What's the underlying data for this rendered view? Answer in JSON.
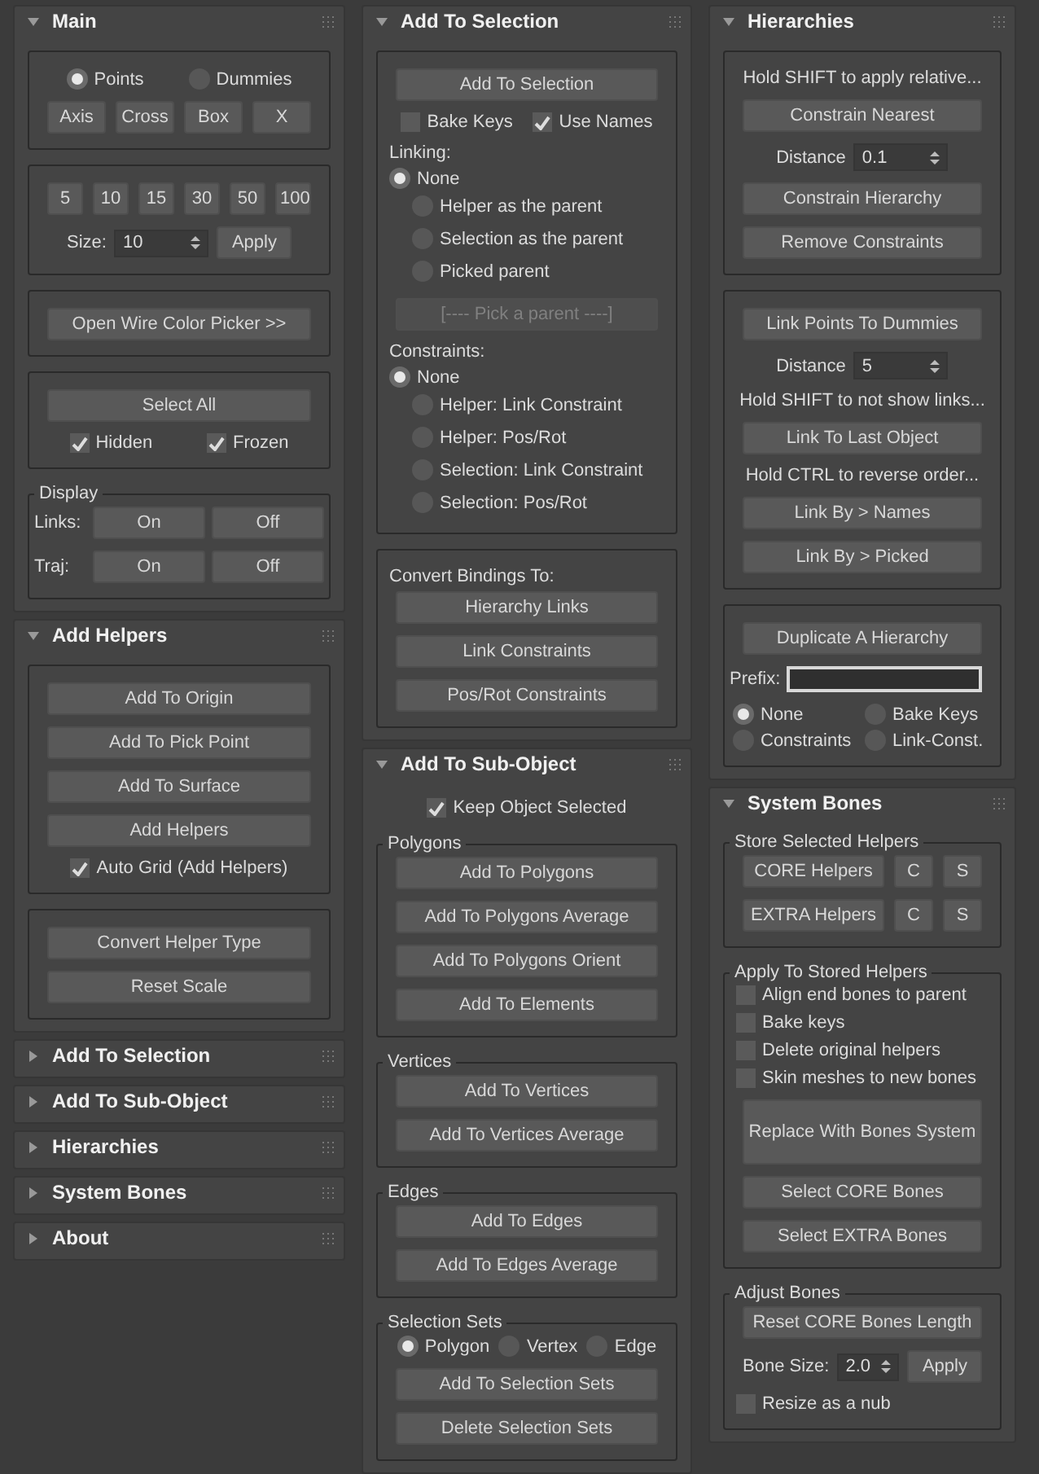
{
  "columns": [
    {
      "rollouts": [
        {
          "title": "Main",
          "expanded": true,
          "groups": [
            {
              "kind": "box",
              "items": [
                {
                  "kind": "radio-row",
                  "options": [
                    {
                      "label": "Points",
                      "selected": true
                    },
                    {
                      "label": "Dummies",
                      "selected": false
                    }
                  ]
                },
                {
                  "kind": "buttons",
                  "buttons": [
                    "Axis",
                    "Cross",
                    "Box",
                    "X"
                  ]
                }
              ]
            },
            {
              "kind": "box",
              "items": [
                {
                  "kind": "buttons",
                  "buttons": [
                    "5",
                    "10",
                    "15",
                    "30",
                    "50",
                    "100"
                  ]
                },
                {
                  "kind": "spinner",
                  "label": "Size:",
                  "value": "10",
                  "button": "Apply"
                }
              ]
            },
            {
              "kind": "box",
              "items": [
                {
                  "kind": "button",
                  "label": "Open Wire Color Picker >>"
                }
              ]
            },
            {
              "kind": "box",
              "items": [
                {
                  "kind": "button",
                  "label": "Select All"
                },
                {
                  "kind": "checks",
                  "options": [
                    {
                      "label": "Hidden",
                      "checked": true
                    },
                    {
                      "label": "Frozen",
                      "checked": true
                    }
                  ]
                }
              ]
            },
            {
              "kind": "box",
              "legend": "Display",
              "items": [
                {
                  "kind": "labeled-buttons",
                  "label": "Links:",
                  "buttons": [
                    "On",
                    "Off"
                  ]
                },
                {
                  "kind": "labeled-buttons",
                  "label": "Traj:",
                  "buttons": [
                    "On",
                    "Off"
                  ]
                }
              ]
            }
          ]
        },
        {
          "title": "Add Helpers",
          "expanded": true,
          "groups": [
            {
              "kind": "box",
              "items": [
                {
                  "kind": "button",
                  "label": "Add To Origin"
                },
                {
                  "kind": "button",
                  "label": "Add To Pick Point"
                },
                {
                  "kind": "button",
                  "label": "Add To Surface"
                },
                {
                  "kind": "button",
                  "label": "Add Helpers"
                },
                {
                  "kind": "checks",
                  "options": [
                    {
                      "label": "Auto Grid (Add Helpers)",
                      "checked": true
                    }
                  ]
                }
              ]
            },
            {
              "kind": "box",
              "items": [
                {
                  "kind": "button",
                  "label": "Convert Helper Type"
                },
                {
                  "kind": "button",
                  "label": "Reset Scale"
                }
              ]
            }
          ]
        },
        {
          "title": "Add To Selection",
          "expanded": false
        },
        {
          "title": "Add To Sub-Object",
          "expanded": false
        },
        {
          "title": "Hierarchies",
          "expanded": false
        },
        {
          "title": "System Bones",
          "expanded": false
        },
        {
          "title": "About",
          "expanded": false
        }
      ]
    },
    {
      "rollouts": [
        {
          "title": "Add To Selection",
          "expanded": true,
          "groups": [
            {
              "kind": "box",
              "items": [
                {
                  "kind": "button",
                  "label": "Add To Selection"
                },
                {
                  "kind": "checks",
                  "options": [
                    {
                      "label": "Bake Keys",
                      "checked": false
                    },
                    {
                      "label": "Use Names",
                      "checked": true
                    }
                  ]
                },
                {
                  "kind": "label",
                  "text": "Linking:"
                },
                {
                  "kind": "radio-list",
                  "options": [
                    {
                      "label": "None",
                      "selected": true
                    },
                    {
                      "label": "Helper as the parent",
                      "selected": false
                    },
                    {
                      "label": "Selection as the parent",
                      "selected": false
                    },
                    {
                      "label": "Picked parent",
                      "selected": false
                    }
                  ]
                },
                {
                  "kind": "button",
                  "label": "[----  Pick a parent  ----]",
                  "disabled": true
                },
                {
                  "kind": "label",
                  "text": "Constraints:"
                },
                {
                  "kind": "radio-list",
                  "options": [
                    {
                      "label": "None",
                      "selected": true
                    },
                    {
                      "label": "Helper: Link Constraint",
                      "selected": false
                    },
                    {
                      "label": "Helper: Pos/Rot",
                      "selected": false
                    },
                    {
                      "label": "Selection: Link Constraint",
                      "selected": false
                    },
                    {
                      "label": "Selection: Pos/Rot",
                      "selected": false
                    }
                  ]
                }
              ]
            },
            {
              "kind": "box",
              "items": [
                {
                  "kind": "label",
                  "text": "Convert Bindings To:"
                },
                {
                  "kind": "button",
                  "label": "Hierarchy Links"
                },
                {
                  "kind": "button",
                  "label": "Link Constraints"
                },
                {
                  "kind": "button",
                  "label": "Pos/Rot Constraints"
                }
              ]
            }
          ]
        },
        {
          "title": "Add To Sub-Object",
          "expanded": true,
          "groups": [
            {
              "kind": "plain",
              "items": [
                {
                  "kind": "checks",
                  "options": [
                    {
                      "label": "Keep Object Selected",
                      "checked": true
                    }
                  ]
                }
              ]
            },
            {
              "kind": "box",
              "legend": "Polygons",
              "items": [
                {
                  "kind": "button",
                  "label": "Add To Polygons"
                },
                {
                  "kind": "button",
                  "label": "Add To Polygons Average"
                },
                {
                  "kind": "button",
                  "label": "Add To Polygons Orient"
                },
                {
                  "kind": "button",
                  "label": "Add To Elements"
                }
              ]
            },
            {
              "kind": "box",
              "legend": "Vertices",
              "items": [
                {
                  "kind": "button",
                  "label": "Add To Vertices"
                },
                {
                  "kind": "button",
                  "label": "Add To Vertices Average"
                }
              ]
            },
            {
              "kind": "box",
              "legend": "Edges",
              "items": [
                {
                  "kind": "button",
                  "label": "Add To Edges"
                },
                {
                  "kind": "button",
                  "label": "Add To Edges Average"
                }
              ]
            },
            {
              "kind": "box",
              "legend": "Selection Sets",
              "items": [
                {
                  "kind": "radio-row",
                  "options": [
                    {
                      "label": "Polygon",
                      "selected": true
                    },
                    {
                      "label": "Vertex",
                      "selected": false
                    },
                    {
                      "label": "Edge",
                      "selected": false
                    }
                  ]
                },
                {
                  "kind": "button",
                  "label": "Add To Selection Sets"
                },
                {
                  "kind": "button",
                  "label": "Delete Selection Sets"
                }
              ]
            }
          ]
        }
      ]
    },
    {
      "rollouts": [
        {
          "title": "Hierarchies",
          "expanded": true,
          "groups": [
            {
              "kind": "box",
              "items": [
                {
                  "kind": "note",
                  "text": "Hold SHIFT to apply relative..."
                },
                {
                  "kind": "button",
                  "label": "Constrain Nearest"
                },
                {
                  "kind": "spinner",
                  "label": "Distance",
                  "value": "0.1"
                },
                {
                  "kind": "button",
                  "label": "Constrain Hierarchy"
                },
                {
                  "kind": "button",
                  "label": "Remove Constraints"
                }
              ]
            },
            {
              "kind": "box",
              "items": [
                {
                  "kind": "button",
                  "label": "Link Points To Dummies"
                },
                {
                  "kind": "spinner",
                  "label": "Distance",
                  "value": "5"
                },
                {
                  "kind": "note",
                  "text": "Hold SHIFT to not show links..."
                },
                {
                  "kind": "button",
                  "label": "Link To Last Object"
                },
                {
                  "kind": "note",
                  "text": "Hold CTRL to reverse order..."
                },
                {
                  "kind": "button",
                  "label": "Link By > Names"
                },
                {
                  "kind": "button",
                  "label": "Link By > Picked"
                }
              ]
            },
            {
              "kind": "box",
              "items": [
                {
                  "kind": "button",
                  "label": "Duplicate A Hierarchy"
                },
                {
                  "kind": "field",
                  "label": "Prefix:"
                },
                {
                  "kind": "radio-grid",
                  "options": [
                    {
                      "label": "None",
                      "selected": true
                    },
                    {
                      "label": "Bake Keys",
                      "selected": false
                    },
                    {
                      "label": "Constraints",
                      "selected": false
                    },
                    {
                      "label": "Link-Const.",
                      "selected": false
                    }
                  ]
                }
              ]
            }
          ]
        },
        {
          "title": "System Bones",
          "expanded": true,
          "groups": [
            {
              "kind": "box",
              "legend": "Store Selected Helpers",
              "items": [
                {
                  "kind": "split",
                  "buttons": [
                    "CORE Helpers",
                    "C",
                    "S"
                  ]
                },
                {
                  "kind": "split",
                  "buttons": [
                    "EXTRA Helpers",
                    "C",
                    "S"
                  ]
                }
              ]
            },
            {
              "kind": "box",
              "legend": "Apply To Stored Helpers",
              "items": [
                {
                  "kind": "check-list",
                  "options": [
                    {
                      "label": "Align end bones to parent",
                      "checked": false
                    },
                    {
                      "label": "Bake keys",
                      "checked": false
                    },
                    {
                      "label": "Delete original helpers",
                      "checked": false
                    },
                    {
                      "label": "Skin meshes to new bones",
                      "checked": false
                    }
                  ]
                },
                {
                  "kind": "big-button",
                  "label": "Replace With Bones System"
                },
                {
                  "kind": "button",
                  "label": "Select CORE Bones"
                },
                {
                  "kind": "button",
                  "label": "Select EXTRA Bones"
                }
              ]
            },
            {
              "kind": "box",
              "legend": "Adjust Bones",
              "items": [
                {
                  "kind": "button",
                  "label": "Reset CORE Bones Length"
                },
                {
                  "kind": "spinner",
                  "label": "Bone Size:",
                  "value": "2.0",
                  "button": "Apply"
                },
                {
                  "kind": "check-list",
                  "options": [
                    {
                      "label": "Resize as a nub",
                      "checked": false
                    }
                  ]
                }
              ]
            }
          ]
        }
      ]
    }
  ]
}
